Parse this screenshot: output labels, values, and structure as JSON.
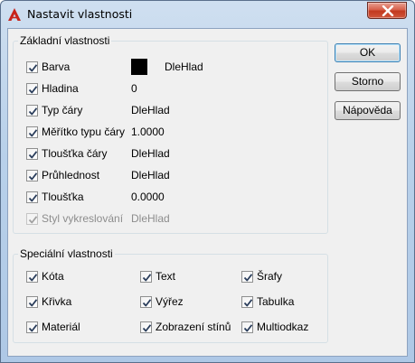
{
  "window": {
    "title": "Nastavit vlastnosti"
  },
  "basic": {
    "legend": "Základní vlastnosti",
    "rows": [
      {
        "label": "Barva",
        "value": "DleHlad",
        "checked": true,
        "enabled": true
      },
      {
        "label": "Hladina",
        "value": "0",
        "checked": true,
        "enabled": true
      },
      {
        "label": "Typ čáry",
        "value": "DleHlad",
        "checked": true,
        "enabled": true
      },
      {
        "label": "Měřítko typu čáry",
        "value": "1.0000",
        "checked": true,
        "enabled": true
      },
      {
        "label": "Tloušťka čáry",
        "value": "DleHlad",
        "checked": true,
        "enabled": true
      },
      {
        "label": "Průhlednost",
        "value": "DleHlad",
        "checked": true,
        "enabled": true
      },
      {
        "label": "Tloušťka",
        "value": "0.0000",
        "checked": true,
        "enabled": true
      },
      {
        "label": "Styl vykreslování",
        "value": "DleHlad",
        "checked": true,
        "enabled": false
      }
    ],
    "swatch_color": "#000000"
  },
  "special": {
    "legend": "Speciální vlastnosti",
    "items": [
      {
        "label": "Kóta",
        "checked": true
      },
      {
        "label": "Text",
        "checked": true
      },
      {
        "label": "Šrafy",
        "checked": true
      },
      {
        "label": "Křivka",
        "checked": true
      },
      {
        "label": "Výřez",
        "checked": true
      },
      {
        "label": "Tabulka",
        "checked": true
      },
      {
        "label": "Materiál",
        "checked": true
      },
      {
        "label": "Zobrazení stínů",
        "checked": true
      },
      {
        "label": "Multiodkaz",
        "checked": true
      }
    ]
  },
  "buttons": {
    "ok": "OK",
    "cancel": "Storno",
    "help": "Nápověda"
  },
  "icons": {
    "app": "autocad-logo-icon",
    "close": "close-icon",
    "check": "checkmark-icon"
  }
}
